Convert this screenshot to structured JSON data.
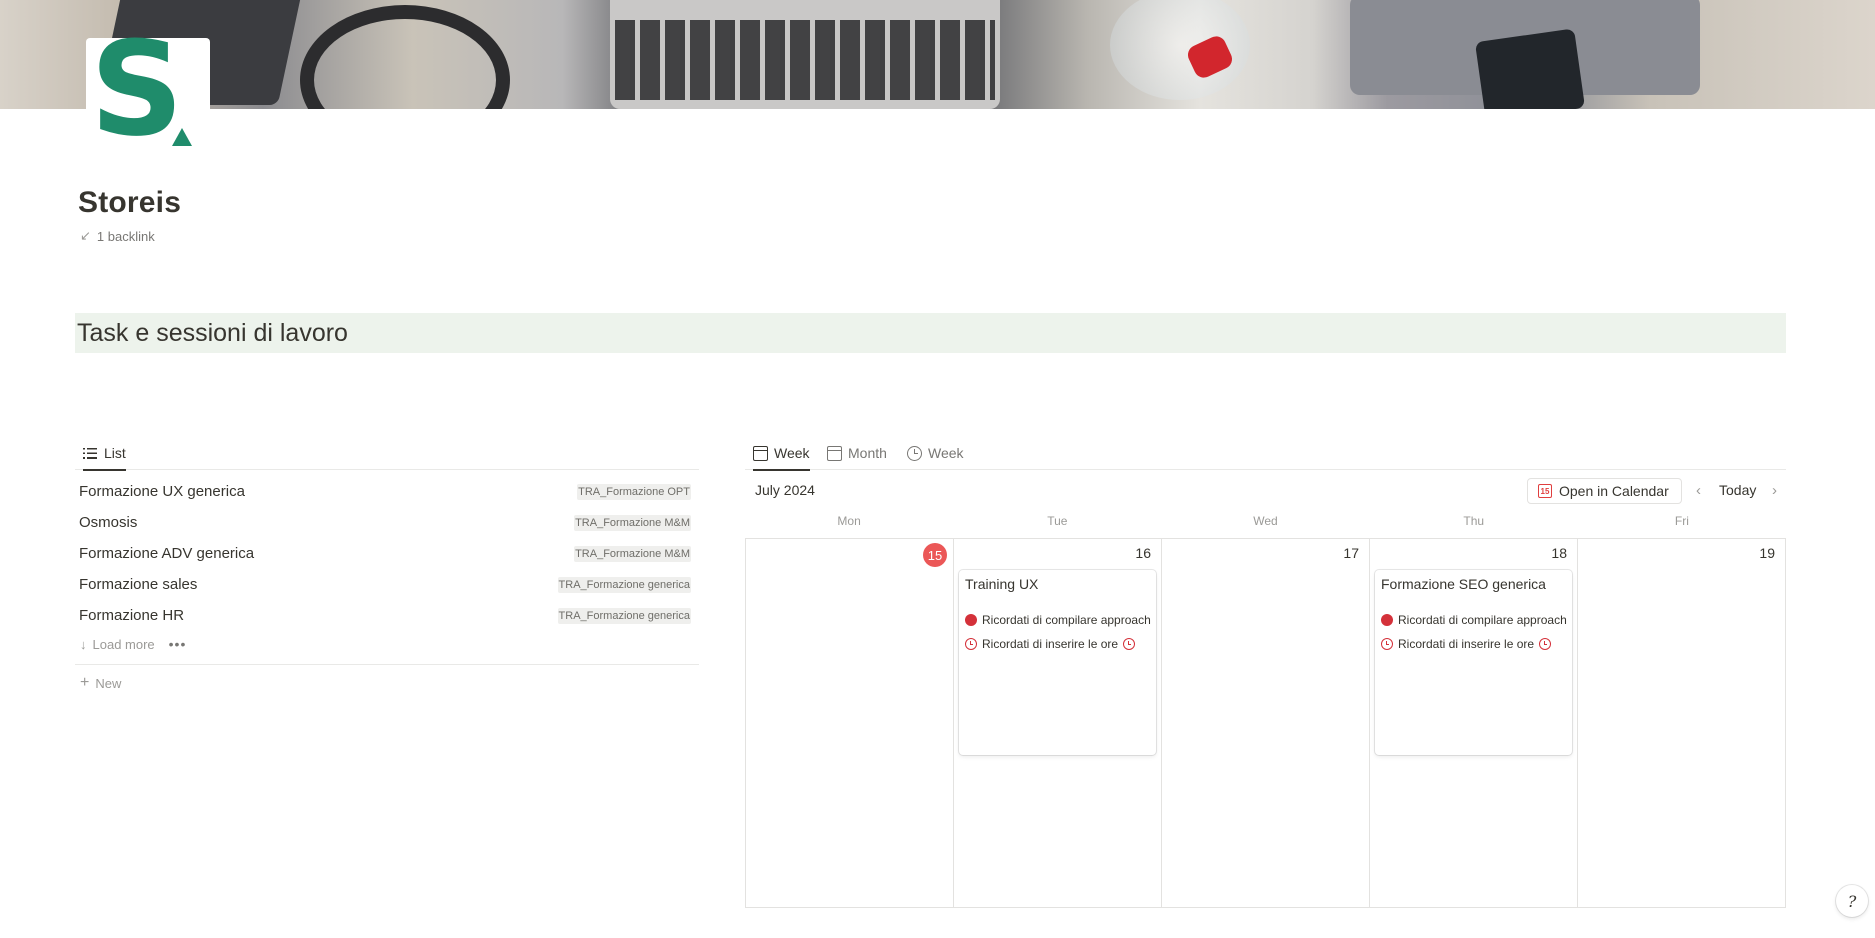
{
  "page": {
    "title": "Storeis",
    "backlink_text": "1 backlink",
    "section_heading": "Task e sessioni di lavoro",
    "logo_letter": "S",
    "brand_color": "#1f8c6b",
    "heading_bg": "#edf3ec"
  },
  "list_view": {
    "tab_label": "List",
    "tab_icon": "list-icon",
    "rows": [
      {
        "name": "Formazione UX generica",
        "tag": "TRA_Formazione OPT"
      },
      {
        "name": "Osmosis",
        "tag": "TRA_Formazione M&M"
      },
      {
        "name": "Formazione ADV generica",
        "tag": "TRA_Formazione M&M"
      },
      {
        "name": "Formazione sales",
        "tag": "TRA_Formazione generica"
      },
      {
        "name": "Formazione HR",
        "tag": "TRA_Formazione generica"
      }
    ],
    "load_more": "Load more",
    "more_dots": "•••",
    "new_label": "New"
  },
  "calendar_view": {
    "tabs": [
      {
        "label": "Week",
        "icon": "calendar-icon",
        "active": true
      },
      {
        "label": "Month",
        "icon": "calendar-icon",
        "active": false
      },
      {
        "label": "Week",
        "icon": "clock-icon",
        "active": false
      }
    ],
    "month_label": "July 2024",
    "open_in_calendar": "Open in Calendar",
    "open_in_calendar_badge": "15",
    "today_label": "Today",
    "prev_glyph": "‹",
    "next_glyph": "›",
    "weekdays": [
      "Mon",
      "Tue",
      "Wed",
      "Thu",
      "Fri"
    ],
    "days": [
      {
        "num": "15",
        "today": true
      },
      {
        "num": "16",
        "today": false
      },
      {
        "num": "17",
        "today": false
      },
      {
        "num": "18",
        "today": false
      },
      {
        "num": "19",
        "today": false
      }
    ],
    "today_color": "#eb5757",
    "events": [
      {
        "title": "Training UX",
        "reminder_1": "Ricordati di compilare approach",
        "reminder_2": "Ricordati di inserire le ore"
      },
      {
        "title": "Formazione SEO generica",
        "reminder_1": "Ricordati di compilare approach",
        "reminder_2": "Ricordati di inserire le ore"
      }
    ]
  },
  "help_glyph": "?"
}
